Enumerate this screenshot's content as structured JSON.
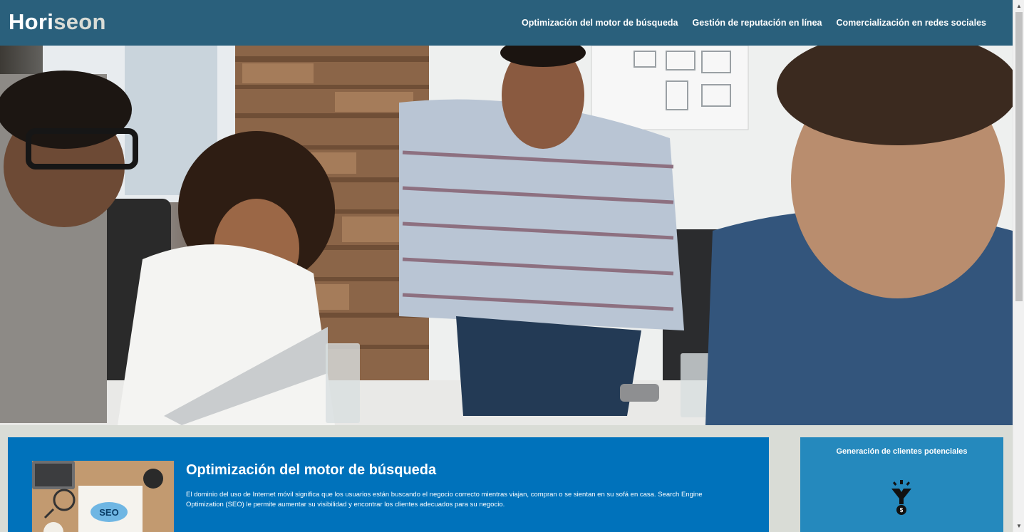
{
  "header": {
    "logo_part1": "Hori",
    "logo_part2": "seon",
    "nav": [
      {
        "label": "Optimización del motor de búsqueda"
      },
      {
        "label": "Gestión de reputación en línea"
      },
      {
        "label": "Comercialización en redes sociales"
      }
    ]
  },
  "hero": {
    "image_icon": "hero-photo-team-meeting"
  },
  "main": {
    "seo": {
      "title": "Optimización del motor de búsqueda",
      "text": "El dominio del uso de Internet móvil significa que los usuarios están buscando el negocio correcto mientras viajan, compran o se sientan en su sofá en casa. Search Engine Optimization (SEO) le permite aumentar su visibilidad y encontrar los clientes adecuados para su negocio.",
      "thumb_text": "SEO"
    }
  },
  "sidebar": {
    "title": "Generación de clientes potenciales",
    "icon": "lead-funnel-icon"
  },
  "colors": {
    "header": "#2a607c",
    "logo_accent": "#d9dcd6",
    "seo_card": "#0072bb",
    "side_card": "#2589bd",
    "page_bg": "#d9dcd6"
  }
}
